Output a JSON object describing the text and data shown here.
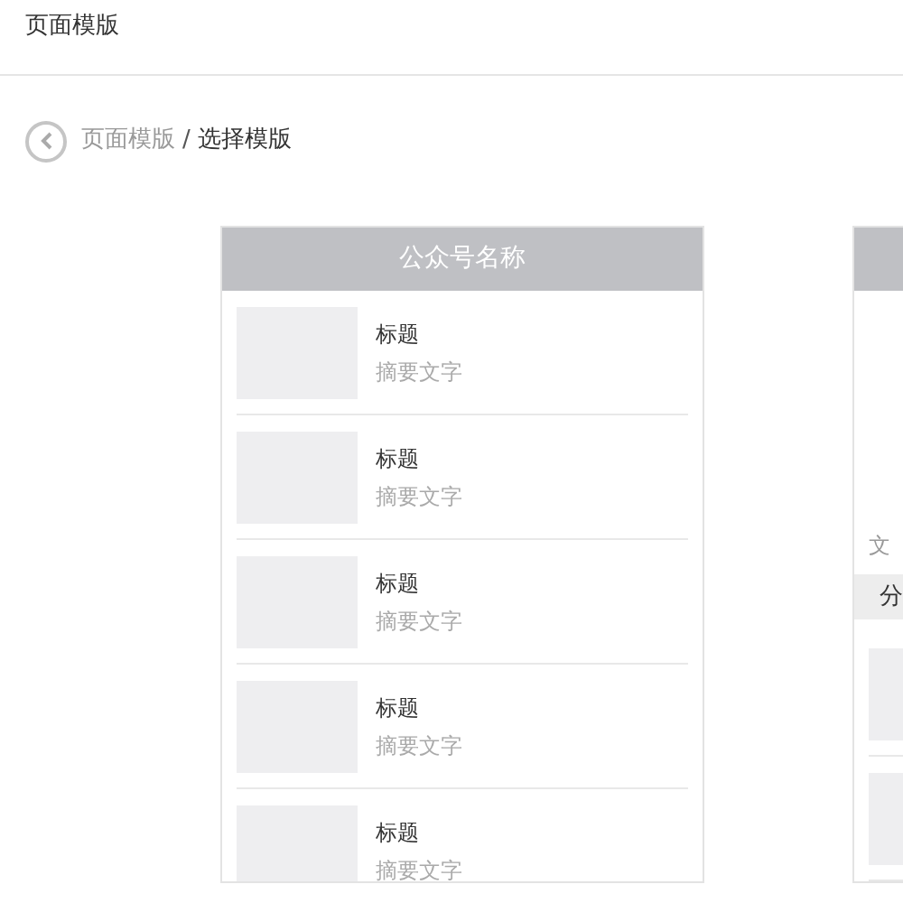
{
  "page_title": "页面模版",
  "breadcrumb": {
    "parent": "页面模版",
    "separator": "/",
    "current": "选择模版"
  },
  "templates": [
    {
      "header": "公众号名称",
      "items": [
        {
          "kind": "article",
          "title": "标题",
          "summary": "摘要文字"
        },
        {
          "kind": "article",
          "title": "标题",
          "summary": "摘要文字"
        },
        {
          "kind": "article",
          "title": "标题",
          "summary": "摘要文字"
        },
        {
          "kind": "article",
          "title": "标题",
          "summary": "摘要文字"
        },
        {
          "kind": "article",
          "title": "标题",
          "summary": "摘要文字"
        }
      ]
    },
    {
      "text": "文",
      "section": "分",
      "items": [
        {
          "kind": "thumbnail"
        },
        {
          "kind": "thumbnail"
        }
      ]
    }
  ]
}
